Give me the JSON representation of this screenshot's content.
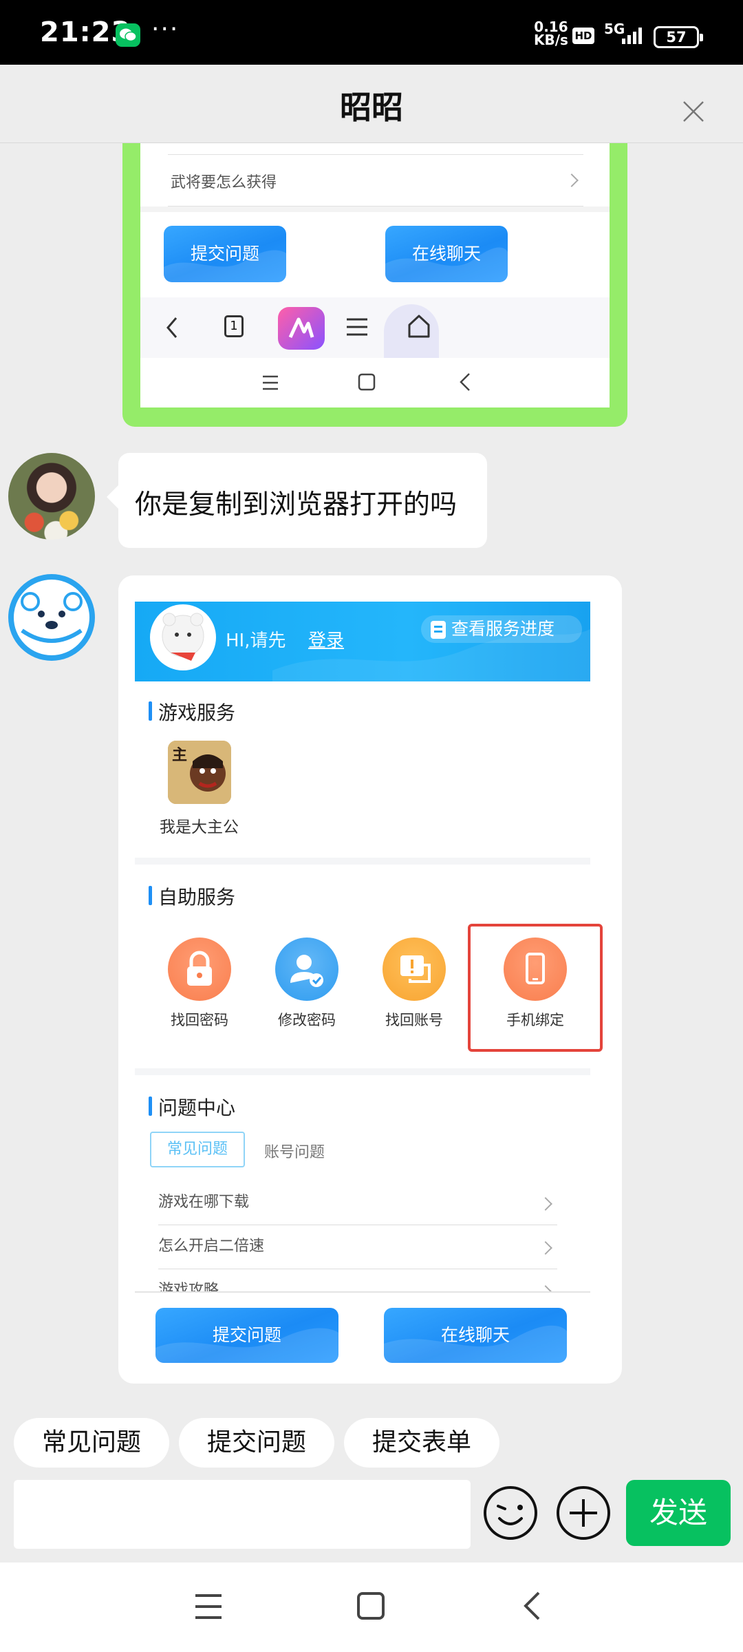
{
  "status_bar": {
    "time": "21:23",
    "more": "···",
    "speed_value": "0.16",
    "speed_unit": "KB/s",
    "hd": "HD",
    "network": "5G",
    "battery": "57"
  },
  "header": {
    "title": "昭昭"
  },
  "screenshot_top": {
    "faq_item": "武将要怎么获得",
    "submit_label": "提交问题",
    "chat_label": "在线聊天",
    "tab_count": "1"
  },
  "message_text": "你是复制到浏览器打开的吗",
  "screenshot_card": {
    "banner": {
      "greeting": "HI,请先",
      "login": "登录",
      "progress": "查看服务进度"
    },
    "game_section_title": "游戏服务",
    "game_name": "我是大主公",
    "self_service_title": "自助服务",
    "services": [
      {
        "label": "找回密码",
        "icon": "lock-icon",
        "color": "#f97e4e"
      },
      {
        "label": "修改密码",
        "icon": "user-check-icon",
        "color": "#2f9cf0"
      },
      {
        "label": "找回账号",
        "icon": "account-alert-icon",
        "color": "#f8a431"
      },
      {
        "label": "手机绑定",
        "icon": "phone-icon",
        "color": "#f97e4e"
      }
    ],
    "question_center_title": "问题中心",
    "tabs": [
      "常见问题",
      "账号问题"
    ],
    "questions": [
      "游戏在哪下载",
      "怎么开启二倍速",
      "游戏攻略"
    ],
    "submit_label": "提交问题",
    "chat_label": "在线聊天"
  },
  "quick_replies": [
    "常见问题",
    "提交问题",
    "提交表单"
  ],
  "input": {
    "placeholder": "",
    "send_label": "发送"
  },
  "colors": {
    "wechat_green": "#07c160",
    "bubble_border_green": "#95ec69",
    "highlight_red": "#e4443b",
    "accent_blue": "#1e8ff5"
  }
}
